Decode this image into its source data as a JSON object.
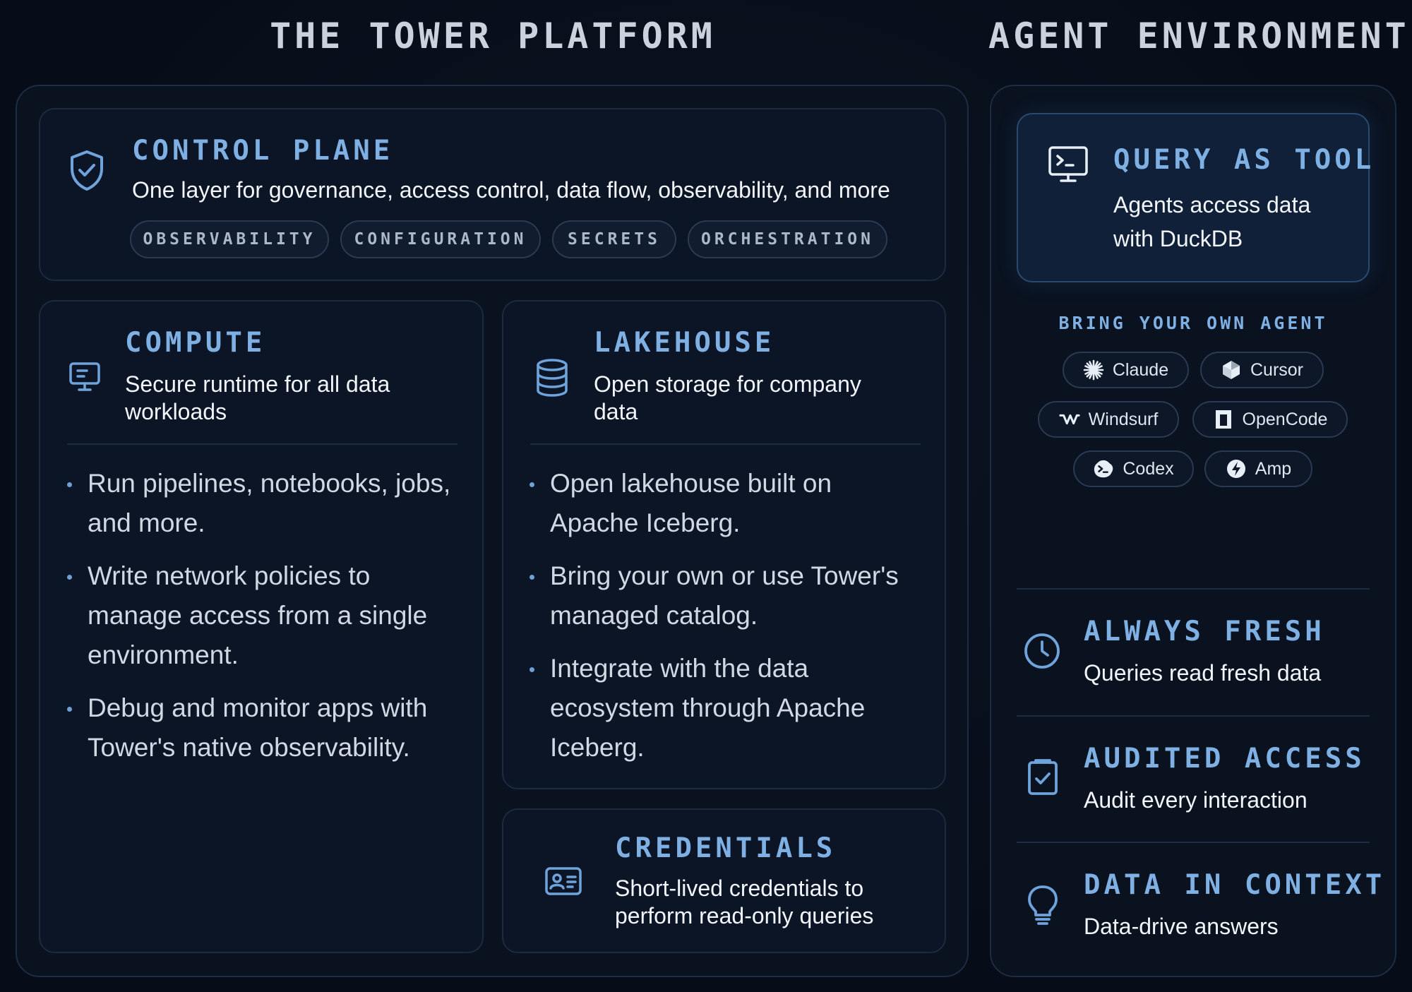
{
  "platform": {
    "title": "THE TOWER PLATFORM",
    "control_plane": {
      "heading": "CONTROL PLANE",
      "description": "One layer for governance, access control, data flow, observability, and more",
      "icon": "shield-check-icon",
      "chips": [
        "OBSERVABILITY",
        "CONFIGURATION",
        "SECRETS",
        "ORCHESTRATION"
      ]
    },
    "compute": {
      "heading": "COMPUTE",
      "description": "Secure runtime for all data workloads",
      "icon": "monitor-icon",
      "bullets": [
        "Run pipelines, notebooks, jobs, and more.",
        "Write network policies to manage access from a single environment.",
        "Debug and monitor apps with Tower's native observability."
      ]
    },
    "lakehouse": {
      "heading": "LAKEHOUSE",
      "description": "Open storage for company data",
      "icon": "database-icon",
      "bullets": [
        "Open lakehouse built on Apache Iceberg.",
        "Bring your own or use Tower's managed catalog.",
        "Integrate with the data ecosystem through Apache Iceberg."
      ]
    },
    "credentials": {
      "heading": "CREDENTIALS",
      "description": "Short-lived credentials to perform read-only queries",
      "icon": "id-card-icon"
    }
  },
  "agent": {
    "title": "AGENT ENVIRONMENT",
    "query_as_tool": {
      "heading": "QUERY AS TOOL",
      "description": "Agents access data with DuckDB",
      "icon": "terminal-icon"
    },
    "byo_label": "BRING YOUR OWN AGENT",
    "agents": [
      {
        "label": "Claude",
        "icon": "claude-icon"
      },
      {
        "label": "Cursor",
        "icon": "cursor-icon"
      },
      {
        "label": "Windsurf",
        "icon": "windsurf-icon"
      },
      {
        "label": "OpenCode",
        "icon": "opencode-icon"
      },
      {
        "label": "Codex",
        "icon": "codex-icon"
      },
      {
        "label": "Amp",
        "icon": "amp-icon"
      }
    ],
    "features": [
      {
        "heading": "ALWAYS FRESH",
        "description": "Queries read fresh data",
        "icon": "clock-icon"
      },
      {
        "heading": "AUDITED ACCESS",
        "description": "Audit every interaction",
        "icon": "clipboard-check-icon"
      },
      {
        "heading": "DATA IN CONTEXT",
        "description": "Data-drive answers",
        "icon": "lightbulb-icon"
      }
    ]
  },
  "colors": {
    "background": "#070d18",
    "accent": "#7fb0e4",
    "text": "#f2f5f9"
  }
}
